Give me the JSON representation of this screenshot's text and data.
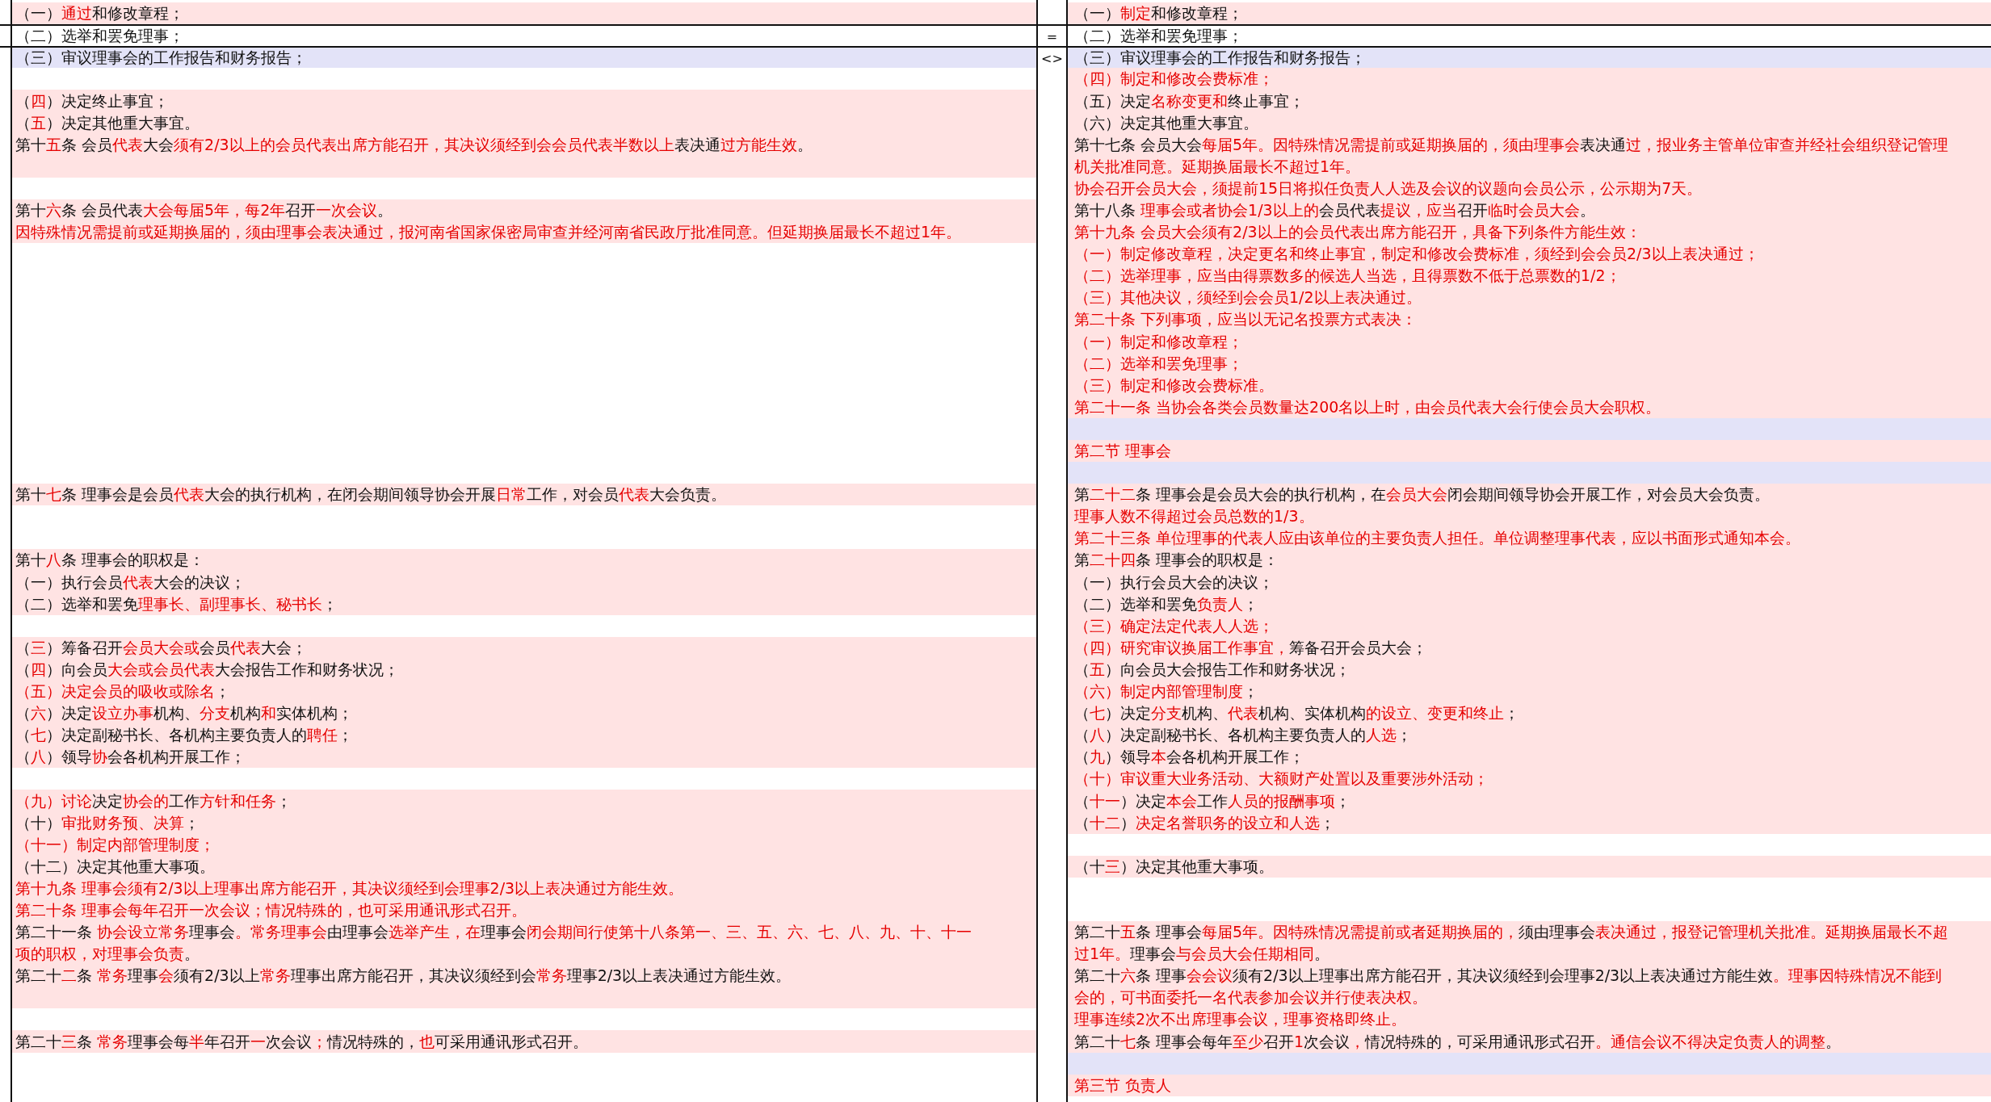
{
  "rows": [
    {
      "left": {
        "text": "（一）**通过**和修改章程；",
        "changed": true,
        "current": false,
        "all_changed": false
      },
      "right": {
        "text": "（一）**制定**和修改章程；",
        "changed": true,
        "current": false,
        "all_changed": false
      }
    },
    {
      "marker": "=",
      "left": {
        "text": "（二）选举和罢免理事；",
        "changed": false,
        "current": false,
        "all_changed": false
      },
      "right": {
        "text": "（二）选举和罢免理事；",
        "changed": false,
        "current": false,
        "all_changed": false
      }
    },
    {
      "marker": "<>",
      "left": {
        "text": "（三）审议理事会的工作报告和财务报告；",
        "changed": false,
        "current": true,
        "all_changed": false
      },
      "right": {
        "text": "（三）审议理事会的工作报告和财务报告；",
        "changed": false,
        "current": true,
        "all_changed": false
      }
    },
    {
      "left": {
        "changed": false,
        "current": false
      },
      "right": {
        "text": "（四）制定和修改会费标准；",
        "changed": true,
        "current": false,
        "all_changed": true
      }
    },
    {
      "left": {
        "text": "（**四**）决定终止事宜；",
        "changed": true,
        "current": false,
        "all_changed": false
      },
      "right": {
        "text": "（五）决定**名称变更和**终止事宜；",
        "changed": true,
        "current": false,
        "all_changed": false
      }
    },
    {
      "left": {
        "text": "（**五**）决定其他重大事宜。",
        "changed": true,
        "current": false,
        "all_changed": false
      },
      "right": {
        "text": "（六）决定其他重大事宜。",
        "changed": true,
        "current": false,
        "all_changed": false
      }
    },
    {
      "left": {
        "text": "第十**五**条 会员**代表**大会**须有2/3以上的会员代表出席方能召开，其决议须经到会会员代表半数以上**表决通**过方能生效**。",
        "changed": true,
        "current": false,
        "all_changed": false
      },
      "right": {
        "text": "第十七条 会员大会**每届5年。因特殊情况需提前或延期换届的，须由理事会**表决通**过，报业务主管单位审查并经社会组织登记管理**",
        "changed": true,
        "current": false,
        "all_changed": false
      }
    },
    {
      "left": {
        "changed": true,
        "current": false
      },
      "right": {
        "text": "机关批准同意。延期换届最长不超过1年。",
        "changed": true,
        "current": false,
        "all_changed": true
      }
    },
    {
      "left": {
        "changed": false,
        "current": false
      },
      "right": {
        "text": "协会召开会员大会，须提前15日将拟任负责人人选及会议的议题向会员公示，公示期为7天。",
        "changed": true,
        "current": false,
        "all_changed": true
      }
    },
    {
      "left": {
        "text": "第十**六**条 会员代表**大会每届5年，每2年**召开**一次会议**。",
        "changed": true,
        "current": false,
        "all_changed": false
      },
      "right": {
        "text": "第十八条 **理事会或者协会1/3以上的**会员代表**提议，应当**召开**临时会员大会**。",
        "changed": true,
        "current": false,
        "all_changed": false
      }
    },
    {
      "left": {
        "text": "因特殊情况需提前或延期换届的，须由理事会表决通过，报河南省国家保密局审查并经河南省民政厅批准同意。但延期换届最长不超过1年。",
        "changed": true,
        "current": false,
        "all_changed": true
      },
      "right": {
        "text": "第十九条 会员大会须有2/3以上的会员代表出席方能召开，具备下列条件方能生效：",
        "changed": true,
        "current": false,
        "all_changed": true
      }
    },
    {
      "left": {
        "changed": false,
        "current": false
      },
      "right": {
        "text": "（一）制定修改章程，决定更名和终止事宜，制定和修改会费标准，须经到会会员2/3以上表决通过；",
        "changed": true,
        "current": false,
        "all_changed": true
      }
    },
    {
      "left": {
        "changed": false,
        "current": false
      },
      "right": {
        "text": "（二）选举理事，应当由得票数多的候选人当选，且得票数不低于总票数的1/2；",
        "changed": true,
        "current": false,
        "all_changed": true
      }
    },
    {
      "left": {
        "changed": false,
        "current": false
      },
      "right": {
        "text": "（三）其他决议，须经到会会员1/2以上表决通过。",
        "changed": true,
        "current": false,
        "all_changed": true
      }
    },
    {
      "left": {
        "changed": false,
        "current": false
      },
      "right": {
        "text": "第二十条 下列事项，应当以无记名投票方式表决：",
        "changed": true,
        "current": false,
        "all_changed": true
      }
    },
    {
      "left": {
        "changed": false,
        "current": false
      },
      "right": {
        "text": "（一）制定和修改章程；",
        "changed": true,
        "current": false,
        "all_changed": true
      }
    },
    {
      "left": {
        "changed": false,
        "current": false
      },
      "right": {
        "text": "（二）选举和罢免理事；",
        "changed": true,
        "current": false,
        "all_changed": true
      }
    },
    {
      "left": {
        "changed": false,
        "current": false
      },
      "right": {
        "text": "（三）制定和修改会费标准。",
        "changed": true,
        "current": false,
        "all_changed": true
      }
    },
    {
      "left": {
        "changed": false,
        "current": false
      },
      "right": {
        "text": "第二十一条 当协会各类会员数量达200名以上时，由会员代表大会行使会员大会职权。",
        "changed": true,
        "current": false,
        "all_changed": true
      }
    },
    {
      "left": {
        "changed": false,
        "current": false
      },
      "right": {
        "changed": false,
        "current": true
      }
    },
    {
      "left": {
        "changed": false,
        "current": false
      },
      "right": {
        "text": "第二节 理事会",
        "changed": true,
        "current": false,
        "all_changed": true
      }
    },
    {
      "left": {
        "changed": false,
        "current": false
      },
      "right": {
        "changed": false,
        "current": true
      }
    },
    {
      "left": {
        "text": "第十**七**条 理事会是会员**代表**大会的执行机构，在闭会期间领导协会开展**日常**工作，对会员**代表**大会负责。",
        "changed": true,
        "current": false,
        "all_changed": false
      },
      "right": {
        "text": "第**二十二**条 理事会是会员大会的执行机构，在**会员大会**闭会期间领导协会开展工作，对会员大会负责。",
        "changed": true,
        "current": false,
        "all_changed": false
      }
    },
    {
      "left": {
        "changed": false,
        "current": false
      },
      "right": {
        "text": "理事人数不得超过会员总数的1/3。",
        "changed": true,
        "current": false,
        "all_changed": true
      }
    },
    {
      "left": {
        "changed": false,
        "current": false
      },
      "right": {
        "text": "第二十三条 单位理事的代表人应由该单位的主要负责人担任。单位调整理事代表，应以书面形式通知本会。",
        "changed": true,
        "current": false,
        "all_changed": true
      }
    },
    {
      "left": {
        "text": "第十**八**条 理事会的职权是：",
        "changed": true,
        "current": false,
        "all_changed": false
      },
      "right": {
        "text": "第**二十四**条 理事会的职权是：",
        "changed": true,
        "current": false,
        "all_changed": false
      }
    },
    {
      "left": {
        "text": "（一）执行会员**代表**大会的决议；",
        "changed": true,
        "current": false,
        "all_changed": false
      },
      "right": {
        "text": "（一）执行会员大会的决议；",
        "changed": true,
        "current": false,
        "all_changed": false
      }
    },
    {
      "left": {
        "text": "（二）选举和罢免**理事长、副理事长、秘书长**；",
        "changed": true,
        "current": false,
        "all_changed": false
      },
      "right": {
        "text": "（二）选举和罢免**负责人**；",
        "changed": true,
        "current": false,
        "all_changed": false
      }
    },
    {
      "left": {
        "changed": false,
        "current": false
      },
      "right": {
        "text": "（三）确定法定代表人人选；",
        "changed": true,
        "current": false,
        "all_changed": true
      }
    },
    {
      "left": {
        "text": "（**三**）筹备召开**会员大会或**会员**代表**大会；",
        "changed": true,
        "current": false,
        "all_changed": false
      },
      "right": {
        "text": "**（四）研究审议换届工作事宜，**筹备召开会员大会；",
        "changed": true,
        "current": false,
        "all_changed": false
      }
    },
    {
      "left": {
        "text": "（**四**）向会员**大会或会员代表**大会报告工作和财务状况；",
        "changed": true,
        "current": false,
        "all_changed": false
      },
      "right": {
        "text": "（**五**）向会员大会报告工作和财务状况；",
        "changed": true,
        "current": false,
        "all_changed": false
      }
    },
    {
      "left": {
        "text": "**（五）决定会员的吸收或除名**；",
        "changed": true,
        "current": false,
        "all_changed": false
      },
      "right": {
        "text": "**（六）制定内部管理制度**；",
        "changed": true,
        "current": false,
        "all_changed": false
      }
    },
    {
      "left": {
        "text": "（**六**）决定**设立办事**机构、**分支**机构**和**实体机构；",
        "changed": true,
        "current": false,
        "all_changed": false
      },
      "right": {
        "text": "（**七**）决定**分支**机构、**代表**机构、实体机构**的设立、变更和终止**；",
        "changed": true,
        "current": false,
        "all_changed": false
      }
    },
    {
      "left": {
        "text": "（**七**）决定副秘书长、各机构主要负责人的**聘任**；",
        "changed": true,
        "current": false,
        "all_changed": false
      },
      "right": {
        "text": "（**八**）决定副秘书长、各机构主要负责人的**人选**；",
        "changed": true,
        "current": false,
        "all_changed": false
      }
    },
    {
      "left": {
        "text": "（**八**）领导**协**会各机构开展工作；",
        "changed": true,
        "current": false,
        "all_changed": false
      },
      "right": {
        "text": "（**九**）领导**本**会各机构开展工作；",
        "changed": true,
        "current": false,
        "all_changed": false
      }
    },
    {
      "left": {
        "changed": false,
        "current": false
      },
      "right": {
        "text": "（十）审议重大业务活动、大额财产处置以及重要涉外活动；",
        "changed": true,
        "current": false,
        "all_changed": true
      }
    },
    {
      "left": {
        "text": "**（九）讨论**决定**协会的**工作**方针和任务**；",
        "changed": true,
        "current": false,
        "all_changed": false
      },
      "right": {
        "text": "（**十一**）决定**本会**工作**人员的报酬事项**；",
        "changed": true,
        "current": false,
        "all_changed": false
      }
    },
    {
      "left": {
        "text": "（十）**审批财务预、决算**；",
        "changed": true,
        "current": false,
        "all_changed": false
      },
      "right": {
        "text": "（**十二**）**决定名誉职务的设立和人选**；",
        "changed": true,
        "current": false,
        "all_changed": false
      }
    },
    {
      "left": {
        "text": "（十一）制定内部管理制度；",
        "changed": true,
        "current": false,
        "all_changed": true
      },
      "right": {
        "changed": false,
        "current": false
      }
    },
    {
      "left": {
        "text": "（十二）决定其他重大事项。",
        "changed": true,
        "current": false,
        "all_changed": false
      },
      "right": {
        "text": "（十**三**）决定其他重大事项。",
        "changed": true,
        "current": false,
        "all_changed": false
      }
    },
    {
      "left": {
        "text": "第十九条 理事会须有2/3以上理事出席方能召开，其决议须经到会理事2/3以上表决通过方能生效。",
        "changed": true,
        "current": false,
        "all_changed": true
      },
      "right": {
        "changed": false,
        "current": false
      }
    },
    {
      "left": {
        "text": "第二十条 理事会每年召开一次会议；情况特殊的，也可采用通讯形式召开。",
        "changed": true,
        "current": false,
        "all_changed": true
      },
      "right": {
        "changed": false,
        "current": false
      }
    },
    {
      "left": {
        "text": "第二十一条 **协会设立常务**理事会**。常务理事会**由理事会**选举产生，在**理事会**闭会期间行使第十八条第一、三、五、六、七、八、九、十、十一**",
        "changed": true,
        "current": false,
        "all_changed": false
      },
      "right": {
        "text": "第二十**五**条 理事会**每届5年。因特殊情况需提前或者延期换届的，**须由理事会**表决通过，报登记管理机关批准。延期换届最长不超**",
        "changed": true,
        "current": false,
        "all_changed": false
      }
    },
    {
      "left": {
        "text": "**项的职权，对理事会负责**。",
        "changed": true,
        "current": false,
        "all_changed": false
      },
      "right": {
        "text": "**过1年。**理事会**与会员大会任期相同**。",
        "changed": true,
        "current": false,
        "all_changed": false
      }
    },
    {
      "left": {
        "text": "第二十**二**条 **常务**理事**会**须有2/3以上**常务**理事出席方能召开，其决议须经到会**常务**理事2/3以上表决通过方能生效。",
        "changed": true,
        "current": false,
        "all_changed": false
      },
      "right": {
        "text": "第二十**六**条 理事**会会议**须有2/3以上理事出席方能召开，其决议须经到会理事2/3以上表决通过方能生效**。理事因特殊情况不能到**",
        "changed": true,
        "current": false,
        "all_changed": false
      }
    },
    {
      "left": {
        "changed": true,
        "current": false
      },
      "right": {
        "text": "会的，可书面委托一名代表参加会议并行使表决权。",
        "changed": true,
        "current": false,
        "all_changed": true
      }
    },
    {
      "left": {
        "changed": false,
        "current": false
      },
      "right": {
        "text": "理事连续2次不出席理事会议，理事资格即终止。",
        "changed": true,
        "current": false,
        "all_changed": true
      }
    },
    {
      "left": {
        "text": "第二十**三**条 **常务**理事会每**半**年召开**一**次会议**；**情况特殊的，**也**可采用通讯形式召开。",
        "changed": true,
        "current": false,
        "all_changed": false
      },
      "right": {
        "text": "第二十**七**条 理事会每年**至少**召开**1**次会议**，**情况特殊的，可采用通讯形式召开**。通信会议不得决定负责人的调整**。",
        "changed": true,
        "current": false,
        "all_changed": false
      }
    },
    {
      "left": {
        "changed": false,
        "current": false
      },
      "right": {
        "changed": false,
        "current": true
      }
    },
    {
      "left": {
        "changed": false,
        "current": false
      },
      "right": {
        "text": "第三节 负责人",
        "changed": true,
        "current": false,
        "all_changed": true
      }
    }
  ]
}
